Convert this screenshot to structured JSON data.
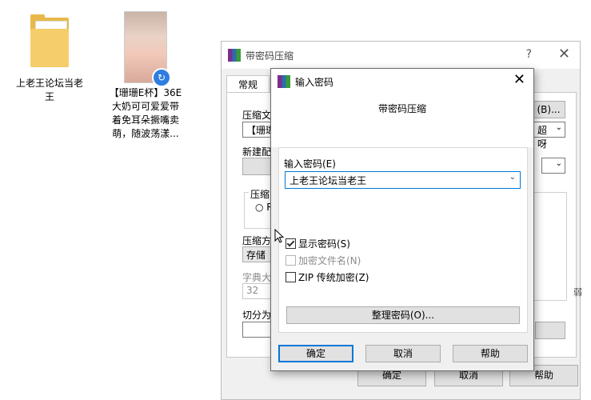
{
  "desktop": {
    "folder_label": "上老王论坛当老\n王",
    "photo_label": "【珊珊E杯】36E\n大奶可可爱爱带\n着免耳朵撅嘴卖\n萌，随波荡漾..."
  },
  "back_window": {
    "title": "带密码压缩",
    "help": "?",
    "close": "✕",
    "tab_general": "常规",
    "archive_label": "压缩文",
    "archive_value": "【珊瑚",
    "browse_btn": "(B)...",
    "update_mode_value": "超呀",
    "profile_label": "新建配",
    "format_label": "压缩",
    "format_radio": "R",
    "method_label": "压缩方",
    "method_value": "存储",
    "dict_label": "字典大",
    "dict_value": "32",
    "split_label": "切分为",
    "side_glyph": "弱",
    "ok": "确定",
    "cancel": "取消",
    "help_btn": "帮助"
  },
  "dialog": {
    "title": "输入密码",
    "close": "✕",
    "heading": "带密码压缩",
    "password_label": "输入密码(E)",
    "password_value": "上老王论坛当老王",
    "show_password": "显示密码(S)",
    "encrypt_names": "加密文件名(N)",
    "zip_legacy": "ZIP 传统加密(Z)",
    "organize_btn": "整理密码(O)...",
    "ok": "确定",
    "cancel": "取消",
    "help": "帮助",
    "show_password_checked": true,
    "encrypt_names_checked": false,
    "zip_legacy_checked": false
  }
}
